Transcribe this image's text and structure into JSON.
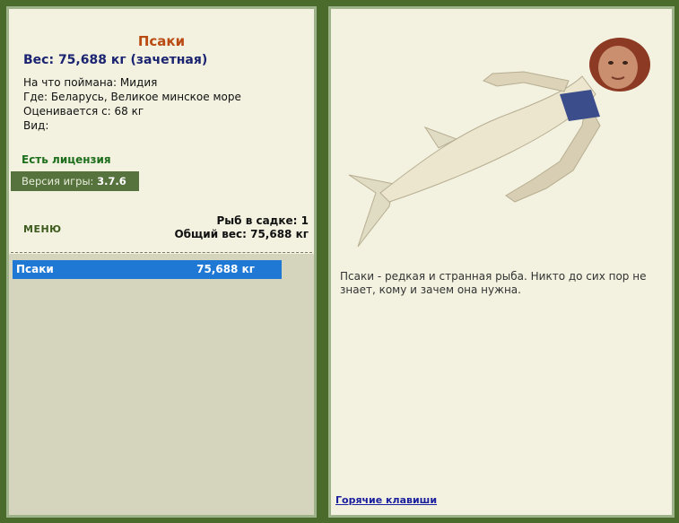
{
  "fish": {
    "name": "Псаки",
    "weight_line": "Вес: 75,688 кг (зачетная)",
    "bait": "На что поймана: Мидия",
    "where": "Где: Беларусь, Великое минское море",
    "valued": "Оценивается с: 68 кг",
    "kind": "Вид:",
    "license": "Есть лицензия"
  },
  "version": {
    "label": "Версия игры:",
    "value": "3.7.6"
  },
  "menu_label": "МЕНЮ",
  "cage": {
    "count_line": "Рыб в садке: 1",
    "total_line": "Общий вес: 75,688 кг",
    "rows": [
      {
        "name": "Псаки",
        "weight": "75,688 кг"
      }
    ]
  },
  "description": "Псаки - редкая и странная рыба. Никто до сих пор не знает, кому и зачем она нужна.",
  "hotkeys_link": "Горячие клавиши",
  "colors": {
    "frame": "#4a6b2c",
    "panel": "#f3f1df",
    "selected_row": "#1e78d4",
    "title": "#b84a12"
  }
}
